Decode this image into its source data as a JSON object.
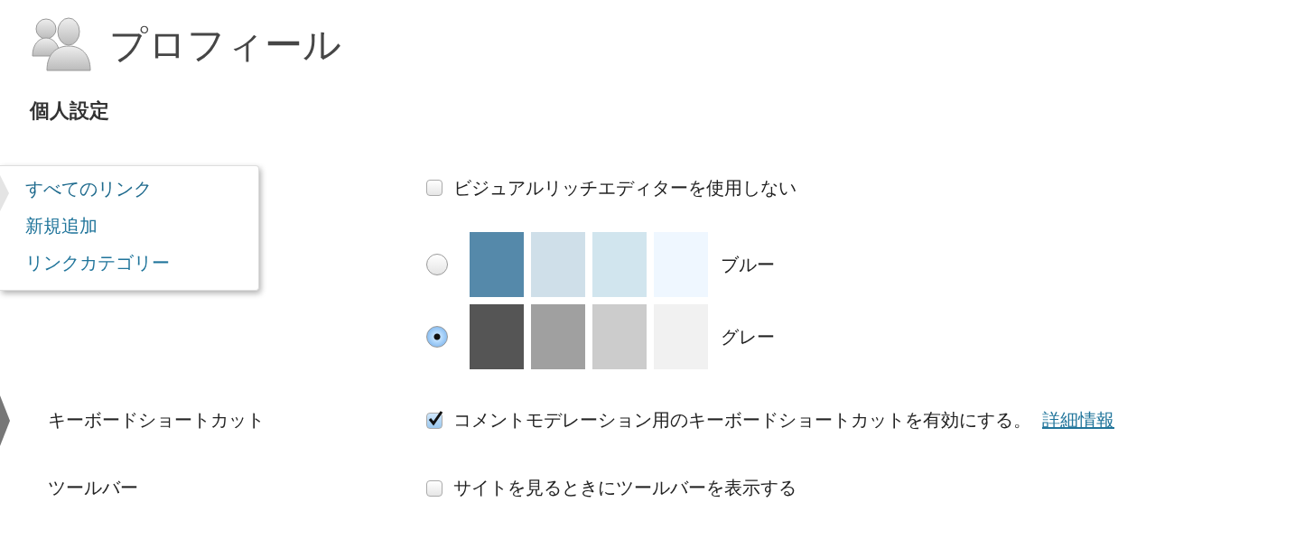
{
  "header": {
    "title": "プロフィール"
  },
  "section_title": "個人設定",
  "flyout_menu": {
    "items": [
      {
        "label": "すべてのリンク",
        "selected": true
      },
      {
        "label": "新規追加",
        "selected": false
      },
      {
        "label": "リンクカテゴリー",
        "selected": false
      }
    ]
  },
  "rows": [
    {
      "kind": "checkbox",
      "checked": false,
      "text": "ビジュアルリッチエディターを使用しない"
    },
    {
      "kind": "color_schemes",
      "schemes": [
        {
          "name": "ブルー",
          "selected": false,
          "swatches": [
            {
              "color": "#5589aa"
            },
            {
              "color": "#cfdfe9"
            },
            {
              "color": "#d1e5ee"
            },
            {
              "color": "#eff7ff"
            }
          ]
        },
        {
          "name": "グレー",
          "selected": true,
          "swatches": [
            {
              "color": "#555555"
            },
            {
              "color": "#a0a0a0"
            },
            {
              "color": "#cccccc"
            },
            {
              "color": "#f1f1f1"
            }
          ]
        }
      ]
    },
    {
      "kind": "checkbox",
      "label": "キーボードショートカット",
      "checked": true,
      "text": "コメントモデレーション用のキーボードショートカットを有効にする。",
      "link": "詳細情報",
      "current": true
    },
    {
      "kind": "checkbox",
      "label": "ツールバー",
      "checked": false,
      "text": "サイトを見るときにツールバーを表示する"
    }
  ]
}
